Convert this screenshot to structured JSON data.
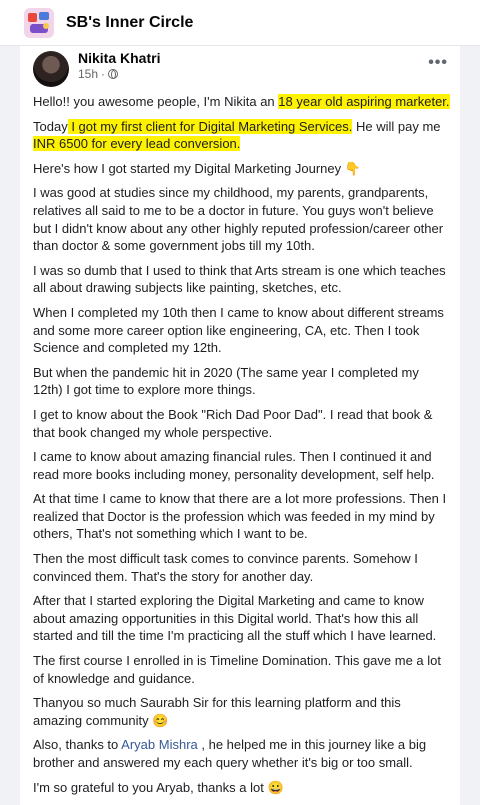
{
  "group": {
    "name": "SB's Inner Circle"
  },
  "post": {
    "author": "Nikita Khatri",
    "time": "15h",
    "more_label": "•••",
    "p1": {
      "a": "Hello!! you awesome people, I'm Nikita an ",
      "hl": "18 year old aspiring marketer."
    },
    "p2": {
      "a": "Today",
      "hl1": " I got my first client for Digital Marketing Services.",
      "b": " He will pay me ",
      "hl2": "INR 6500 for every lead conversion."
    },
    "p3": "Here's how I got started my Digital Marketing Journey 👇",
    "p4": "I was good at studies since my childhood, my parents, grandparents, relatives all said to me to be a doctor in future. You guys won't believe but I didn't know about any other highly reputed profession/career other than doctor & some government jobs till my 10th.",
    "p5": "I was so dumb that I used to think that Arts stream is one which teaches all about drawing subjects like painting, sketches, etc.",
    "p6": "When I completed my 10th then I came to know about different streams and some more career option like engineering, CA, etc. Then I took Science and completed my 12th.",
    "p7": "But when the pandemic hit in 2020 (The same year I completed my 12th) I got time to explore more things.",
    "p8": "I get to know about the Book \"Rich Dad Poor Dad\". I read that book & that book changed my whole perspective.",
    "p9": "I came to know about amazing financial rules. Then I continued it and read more books including money, personality development, self help.",
    "p10": "At that time I came to know that there are a lot more professions. Then I realized that Doctor is the profession which was feeded in my mind by others, That's not something which I want to be.",
    "p11": "Then the most difficult task comes to convince parents. Somehow I convinced them. That's the story for another day.",
    "p12": "After that I started exploring the Digital Marketing and came to know about amazing opportunities in this Digital world. That's how this all started and till the time I'm practicing all the stuff which I have learned.",
    "p13": "The first course I enrolled in is Timeline Domination. This gave me a lot of knowledge and guidance.",
    "p14": "Thanyou so much Saurabh Sir for this learning platform and this amazing community 😊",
    "p15": {
      "a": "Also, thanks to ",
      "link": "Aryab Mishra",
      "b": " , he helped me in this journey like a big brother and answered my each query whether it's big or too small."
    },
    "p16": "I'm so grateful to you Aryab, thanks a lot 😀"
  }
}
